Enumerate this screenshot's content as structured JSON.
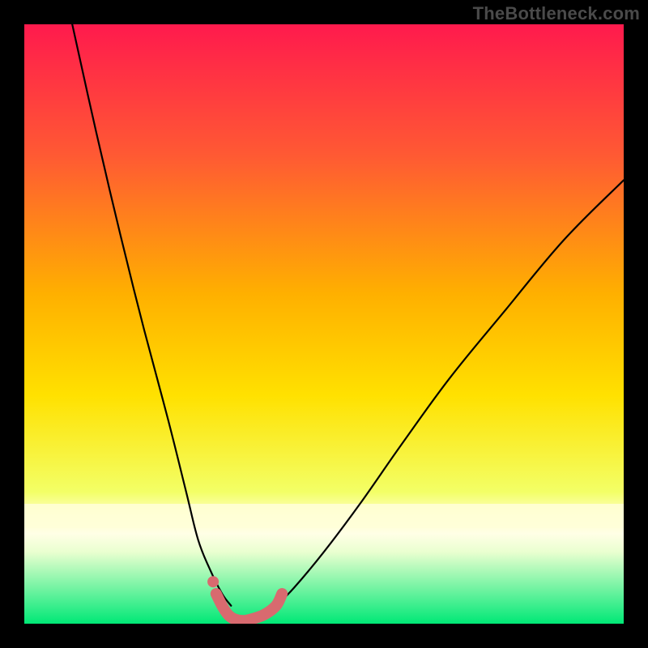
{
  "watermark": "TheBottleneck.com",
  "chart_data": {
    "type": "line",
    "title": "",
    "xlabel": "",
    "ylabel": "",
    "xlim": [
      0,
      100
    ],
    "ylim": [
      0,
      100
    ],
    "background_gradient": {
      "top": "#ff1a4d",
      "mid_upper": "#ff7a2a",
      "mid": "#ffd400",
      "mid_lower": "#f6ff5c",
      "band": "#ffffc0",
      "bottom": "#00e876"
    },
    "series": [
      {
        "name": "left-arm",
        "x": [
          8,
          12,
          16,
          20,
          24,
          27,
          29,
          31,
          33,
          34.5
        ],
        "y": [
          100,
          82,
          65,
          49,
          34,
          22,
          14,
          9,
          5,
          3
        ]
      },
      {
        "name": "right-arm",
        "x": [
          42,
          45,
          50,
          56,
          63,
          71,
          80,
          90,
          100
        ],
        "y": [
          3,
          6,
          12,
          20,
          30,
          41,
          52,
          64,
          74
        ]
      },
      {
        "name": "valley-marker",
        "x": [
          32,
          33,
          34,
          35,
          36.5,
          38,
          40,
          42,
          43
        ],
        "y": [
          5,
          3,
          1.5,
          0.8,
          0.5,
          0.8,
          1.5,
          3,
          5
        ]
      }
    ],
    "marker_point": {
      "x": 31.5,
      "y": 7
    },
    "annotations": []
  }
}
